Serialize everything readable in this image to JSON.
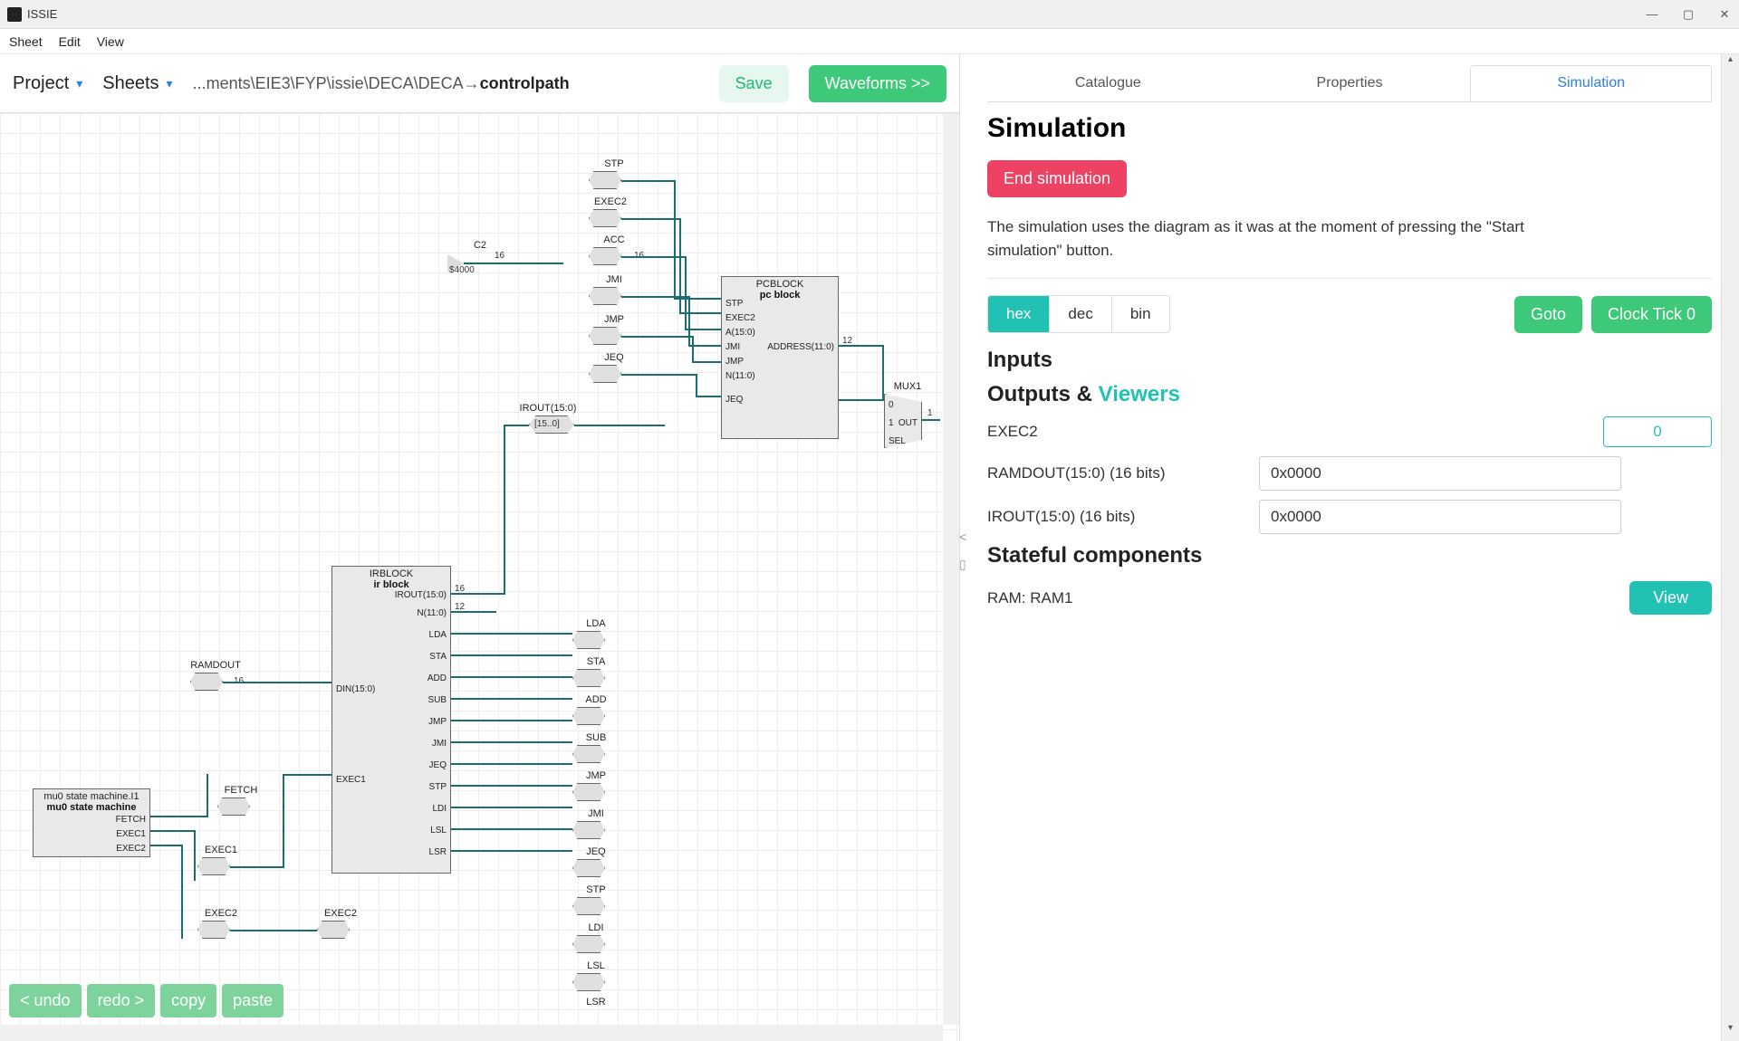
{
  "titlebar": {
    "app": "ISSIE"
  },
  "win": {
    "min": "—",
    "max": "▢",
    "close": "✕"
  },
  "menu": {
    "sheet": "Sheet",
    "edit": "Edit",
    "view": "View"
  },
  "toolbar": {
    "project": "Project",
    "sheets": "Sheets",
    "path_prefix": "...ments\\EIE3\\FYP\\issie\\DECA\\DECA→",
    "path_bold": "controlpath",
    "save": "Save",
    "waveforms": "Waveforms >>"
  },
  "edit": {
    "undo": "< undo",
    "redo": "redo >",
    "copy": "copy",
    "paste": "paste"
  },
  "tabs": {
    "catalogue": "Catalogue",
    "properties": "Properties",
    "simulation": "Simulation"
  },
  "sim": {
    "heading": "Simulation",
    "end": "End simulation",
    "note": "The simulation uses the diagram as it was at the moment of pressing the \"Start simulation\" button.",
    "radix": {
      "hex": "hex",
      "dec": "dec",
      "bin": "bin"
    },
    "goto": "Goto",
    "clock": "Clock Tick 0",
    "inputs": "Inputs",
    "outputs": "Outputs & ",
    "viewers": "Viewers",
    "rows": {
      "exec2": {
        "k": "EXEC2",
        "v": "0"
      },
      "ramdout": {
        "k": "RAMDOUT(15:0) (16 bits)",
        "v": "0x0000"
      },
      "irout": {
        "k": "IROUT(15:0) (16 bits)",
        "v": "0x0000"
      }
    },
    "stateful": "Stateful components",
    "ram": {
      "name": "RAM: RAM1",
      "view": "View"
    }
  },
  "circuit": {
    "c2": "C2",
    "c2val": "$4000",
    "stp": "STP",
    "exec2": "EXEC2",
    "acc": "ACC",
    "jmi": "JMI",
    "jmp": "JMP",
    "jeq": "JEQ",
    "irout": "IROUT(15:0)",
    "iroutbits": "[15..0]",
    "pcblock": {
      "name": "PCBLOCK",
      "sub": "pc block",
      "ports": {
        "stp": "STP",
        "exec2": "EXEC2",
        "a": "A(15:0)",
        "jmi": "JMI",
        "jmp": "JMP",
        "jeq": "JEQ",
        "n": "N(11:0)",
        "addr": "ADDRESS(11:0)"
      }
    },
    "mux": {
      "name": "MUX1",
      "p0": "0",
      "p1": "1",
      "out": "OUT",
      "sel": "SEL"
    },
    "irblock": {
      "name": "IRBLOCK",
      "sub": "ir block",
      "portsR": [
        "IROUT(15:0)",
        "N(11:0)",
        "LDA",
        "STA",
        "ADD",
        "SUB",
        "JMP",
        "JMI",
        "JEQ",
        "STP",
        "LDI",
        "LSL",
        "LSR"
      ],
      "portsL": {
        "din": "DIN(15:0)",
        "exec1": "EXEC1"
      },
      "busR": {
        "irout": "16",
        "n": "12"
      }
    },
    "ramdout": "RAMDOUT",
    "ramdout_bits": "16",
    "sm": {
      "name": "mu0 state machine.I1",
      "sub": "mu0 state machine",
      "ports": [
        "FETCH",
        "EXEC1",
        "EXEC2"
      ]
    },
    "fetch": "FETCH",
    "exec1": "EXEC1",
    "exec2b": "EXEC2",
    "rightStack": [
      "LDA",
      "STA",
      "ADD",
      "SUB",
      "JMP",
      "JMI",
      "JEQ",
      "STP",
      "LDI",
      "LSL",
      "LSR"
    ],
    "bus16a": "16",
    "bus16b": "16",
    "bus12": "12",
    "one": "1"
  }
}
